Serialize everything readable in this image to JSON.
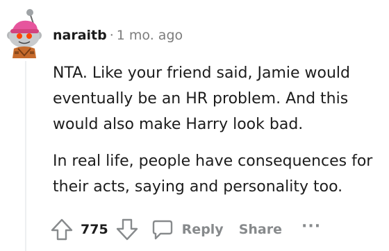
{
  "comment": {
    "username": "naraitb",
    "separator": "·",
    "timestamp": "1 mo. ago",
    "paragraphs": [
      "NTA. Like your friend said, Jamie would\neventually be an HR problem. And this\nwould also make Harry look bad.",
      "In real life, people have consequences for\ntheir acts, saying and personality too."
    ],
    "score": "775",
    "reply_label": "Reply",
    "share_label": "Share",
    "more_label": "···"
  },
  "icons": {
    "avatar": "reddit-snoo-avatar",
    "upvote": "upvote-arrow-icon",
    "downvote": "downvote-arrow-icon",
    "reply": "speech-bubble-icon"
  }
}
